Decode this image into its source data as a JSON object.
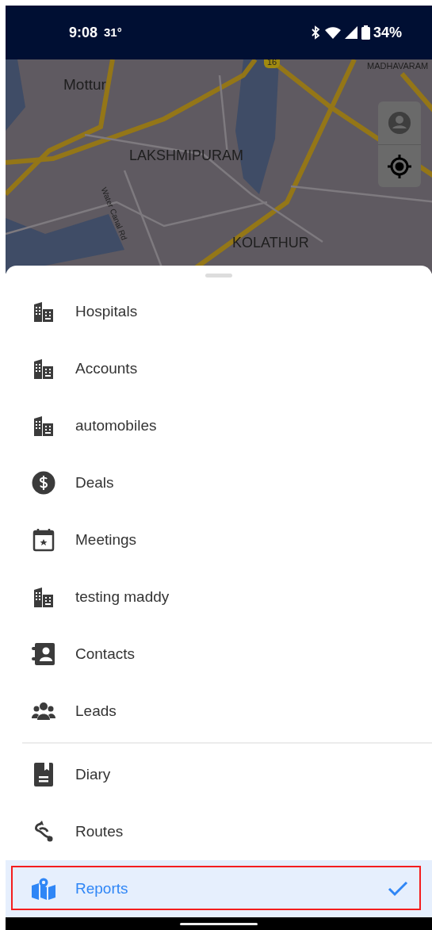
{
  "status_bar": {
    "time": "9:08",
    "temperature": "31°",
    "battery": "34%"
  },
  "map": {
    "labels": [
      {
        "text": "16",
        "kind": "shield"
      },
      {
        "text": "MADHAVARAM",
        "kind": "small"
      },
      {
        "text": "Mottur",
        "kind": "place"
      },
      {
        "text": "LAKSHMIPURAM",
        "kind": "district"
      },
      {
        "text": "Water Canal Rd",
        "kind": "road"
      },
      {
        "text": "KOLATHUR",
        "kind": "district"
      }
    ]
  },
  "menu_groups": [
    {
      "items": [
        {
          "label": "Hospitals",
          "kind": "building",
          "selected": false,
          "highlighted": false
        },
        {
          "label": "Accounts",
          "kind": "building",
          "selected": false,
          "highlighted": false
        },
        {
          "label": "automobiles",
          "kind": "building",
          "selected": false,
          "highlighted": false
        },
        {
          "label": "Deals",
          "kind": "dollar",
          "selected": false,
          "highlighted": false
        },
        {
          "label": "Meetings",
          "kind": "calendar",
          "selected": false,
          "highlighted": false
        },
        {
          "label": "testing maddy",
          "kind": "building",
          "selected": false,
          "highlighted": false
        },
        {
          "label": "Contacts",
          "kind": "contacts",
          "selected": false,
          "highlighted": false
        },
        {
          "label": "Leads",
          "kind": "people",
          "selected": false,
          "highlighted": false
        }
      ]
    },
    {
      "items": [
        {
          "label": "Diary",
          "kind": "diary",
          "selected": false,
          "highlighted": false
        },
        {
          "label": "Routes",
          "kind": "route",
          "selected": false,
          "highlighted": false
        },
        {
          "label": "Reports",
          "kind": "map",
          "selected": true,
          "highlighted": true
        }
      ]
    }
  ]
}
